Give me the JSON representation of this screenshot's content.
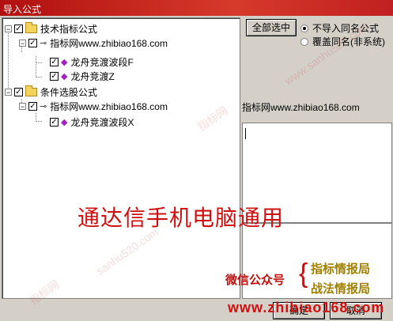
{
  "window": {
    "title": "导入公式"
  },
  "tree": {
    "groups": [
      {
        "label": "技术指标公式",
        "checked": true,
        "children": [
          {
            "label": "指标网www.zhibiao168.com",
            "checked": true,
            "items": [
              {
                "label": "龙舟竞渡波段F",
                "checked": true
              },
              {
                "label": "龙舟竞渡Z",
                "checked": true
              }
            ]
          }
        ]
      },
      {
        "label": "条件选股公式",
        "checked": true,
        "children": [
          {
            "label": "指标网www.zhibiao168.com",
            "checked": true,
            "items": [
              {
                "label": "龙舟竞渡波段X",
                "checked": true
              }
            ]
          }
        ]
      }
    ]
  },
  "right": {
    "select_all": "全部选中",
    "radio1": "不导入同名公式",
    "radio2": "覆盖同名(非系统)",
    "name": "指标网www.zhibiao168.com"
  },
  "overlay": {
    "headline": "通达信手机电脑通用",
    "wechat": "微信公众号",
    "wx1": "指标情报局",
    "wx2": "战法情报局",
    "url": "www.zhibiao168.com",
    "wm1": "www.sanhu520.com",
    "wm2": "指标网",
    "wm3": "sanhu520.com"
  },
  "footer": {
    "ok": "确定",
    "cancel": "取消"
  }
}
